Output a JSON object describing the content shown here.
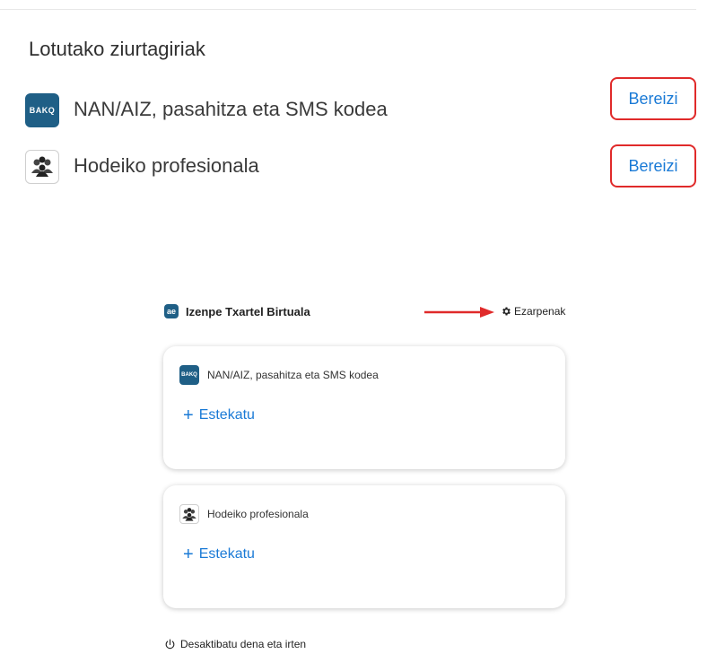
{
  "linked_certificates": {
    "title": "Lotutako ziurtagiriak",
    "items": [
      {
        "label": "NAN/AIZ, pasahitza eta SMS kodea",
        "icon": "bakq-icon",
        "icon_text": "BAKQ",
        "action_label": "Bereizi"
      },
      {
        "label": "Hodeiko profesionala",
        "icon": "people-icon",
        "action_label": "Bereizi"
      }
    ]
  },
  "app": {
    "logo_text": "ae",
    "title": "Izenpe Txartel Birtuala",
    "settings_label": "Ezarpenak",
    "cards": [
      {
        "label": "NAN/AIZ, pasahitza eta SMS kodea",
        "icon": "bakq-icon",
        "icon_text": "BAKQ",
        "action_label": "Estekatu"
      },
      {
        "label": "Hodeiko profesionala",
        "icon": "people-icon",
        "action_label": "Estekatu"
      }
    ],
    "logout_label": "Desaktibatu dena eta irten"
  },
  "colors": {
    "link_blue": "#1a7ad6",
    "highlight_red": "#e02a2a",
    "bakq_blue": "#1f5f86"
  }
}
